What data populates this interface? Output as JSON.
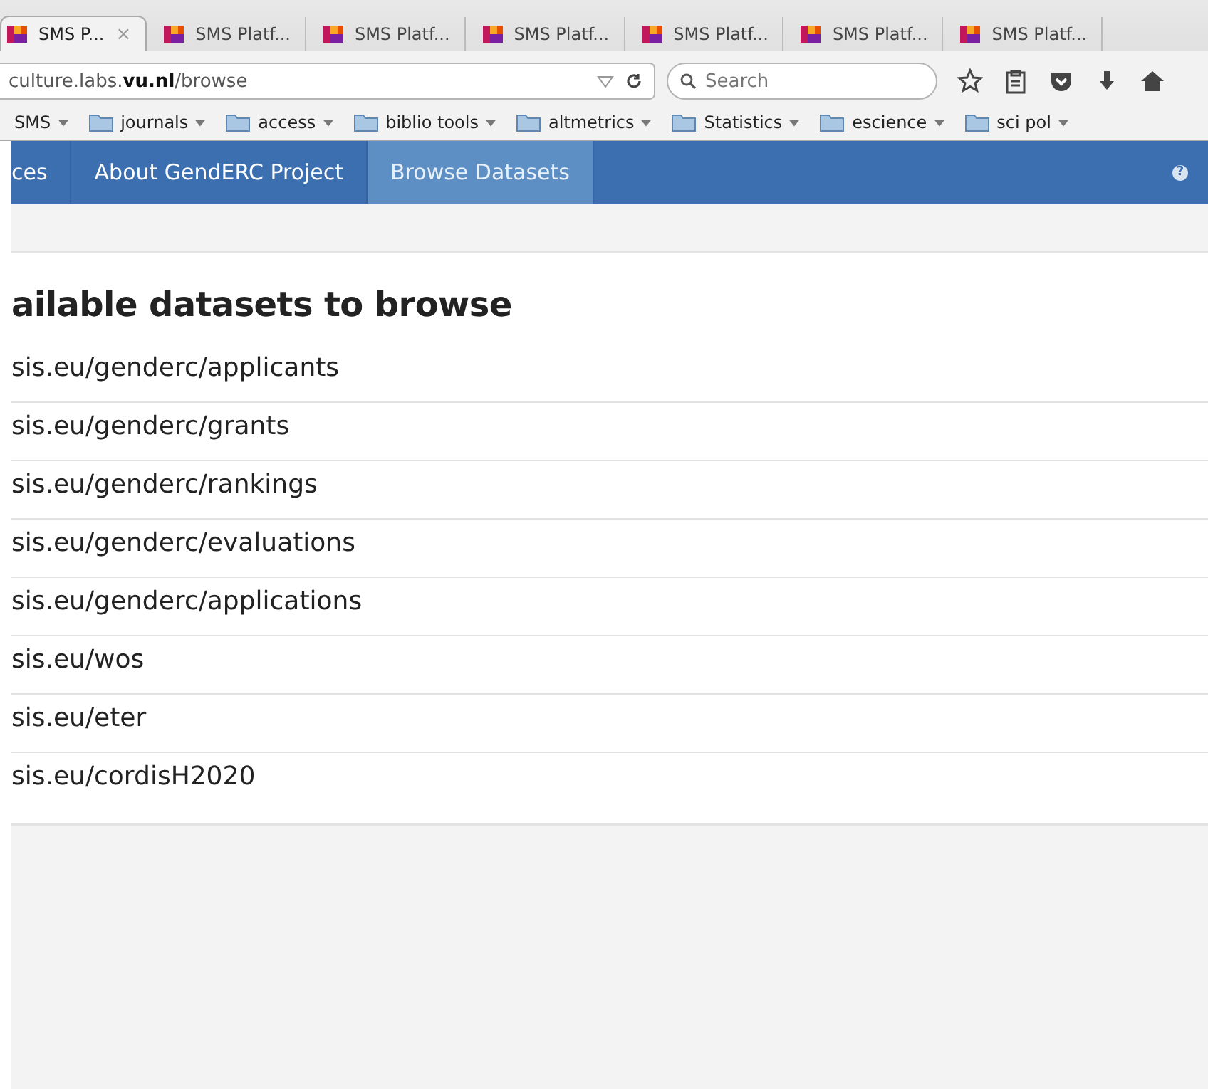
{
  "browser": {
    "tabs": [
      {
        "title": "SMS P...",
        "selected": true,
        "close": "×"
      },
      {
        "title": "SMS Platf...",
        "selected": false
      },
      {
        "title": "SMS Platf...",
        "selected": false
      },
      {
        "title": "SMS Platf...",
        "selected": false
      },
      {
        "title": "SMS Platf...",
        "selected": false
      },
      {
        "title": "SMS Platf...",
        "selected": false
      },
      {
        "title": "SMS Platf...",
        "selected": false
      }
    ],
    "address": "culture.labs.**vu.nl**/browse",
    "search": {
      "placeholder": "Search"
    },
    "bookmarks": [
      {
        "label": "SMS",
        "kind": "menu"
      },
      {
        "label": "journals",
        "kind": "folder"
      },
      {
        "label": "access",
        "kind": "folder"
      },
      {
        "label": "biblio tools",
        "kind": "folder"
      },
      {
        "label": "altmetrics",
        "kind": "folder"
      },
      {
        "label": "Statistics",
        "kind": "folder"
      },
      {
        "label": "escience",
        "kind": "folder"
      },
      {
        "label": "sci pol",
        "kind": "folder"
      }
    ]
  },
  "nav": {
    "items": [
      {
        "label": "ces",
        "selected": false
      },
      {
        "label": "About GendERC Project",
        "selected": false
      },
      {
        "label": "Browse Datasets",
        "selected": true
      }
    ],
    "help": "?"
  },
  "content": {
    "heading": "ailable datasets to browse",
    "datasets": [
      "sis.eu/genderc/applicants",
      "sis.eu/genderc/grants",
      "sis.eu/genderc/rankings",
      "sis.eu/genderc/evaluations",
      "sis.eu/genderc/applications",
      "sis.eu/wos",
      "sis.eu/eter",
      "sis.eu/cordisH2020"
    ]
  }
}
